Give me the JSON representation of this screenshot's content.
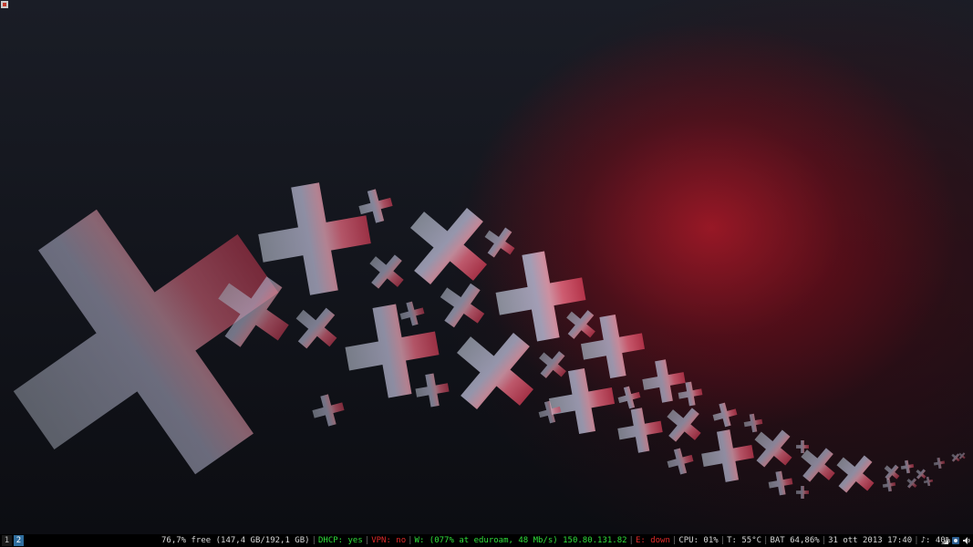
{
  "workspaces": [
    {
      "label": "1",
      "active": false
    },
    {
      "label": "2",
      "active": true
    }
  ],
  "status": {
    "disk": "76,7% free (147,4 GB/192,1 GB)",
    "dhcp": "DHCP: yes",
    "vpn": "VPN: no",
    "wifi": "W: (077% at eduroam, 48 Mb/s) 150.80.131.82",
    "ethernet": "E: down",
    "cpu": "CPU: 01%",
    "temp": "T: 55°C",
    "battery": "BAT 64,86%",
    "datetime": "31 ott 2013 17:40",
    "volume": "♪: 40%"
  },
  "tray": [
    "network-icon",
    "settings-icon",
    "volume-icon"
  ],
  "colors": {
    "ok": "#2fdf3a",
    "bad": "#e02a2a",
    "active_workspace": "#2f6e9f"
  }
}
